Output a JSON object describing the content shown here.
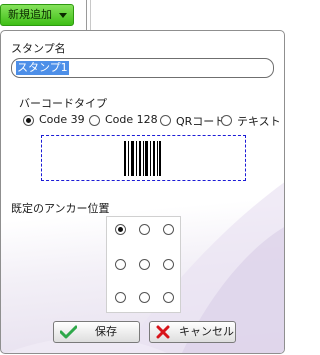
{
  "toolbar": {
    "new_button_label": "新規追加"
  },
  "dialog": {
    "stamp_name_label": "スタンプ名",
    "stamp_name_value": "スタンプ1",
    "barcode_type_label": "バーコードタイプ",
    "barcode_types": [
      {
        "label": "Code 39",
        "selected": true
      },
      {
        "label": "Code 128",
        "selected": false
      },
      {
        "label": "QRコード",
        "selected": false
      },
      {
        "label": "テキスト",
        "selected": false
      }
    ],
    "anchor_label": "既定のアンカー位置",
    "anchor_positions": [
      {
        "name": "top-left",
        "selected": true
      },
      {
        "name": "top-center",
        "selected": false
      },
      {
        "name": "top-right",
        "selected": false
      },
      {
        "name": "middle-left",
        "selected": false
      },
      {
        "name": "middle-center",
        "selected": false
      },
      {
        "name": "middle-right",
        "selected": false
      },
      {
        "name": "bottom-left",
        "selected": false
      },
      {
        "name": "bottom-center",
        "selected": false
      },
      {
        "name": "bottom-right",
        "selected": false
      }
    ],
    "save_label": "保存",
    "cancel_label": "キャンセル"
  },
  "colors": {
    "accent_green": "#3fbf16",
    "save_icon": "#2ea84a",
    "cancel_icon": "#d8131a",
    "barcode_border": "#1b1bd6"
  },
  "icons": {
    "dropdown": "triangle-down-icon",
    "save": "checkmark-icon",
    "cancel": "x-icon"
  }
}
